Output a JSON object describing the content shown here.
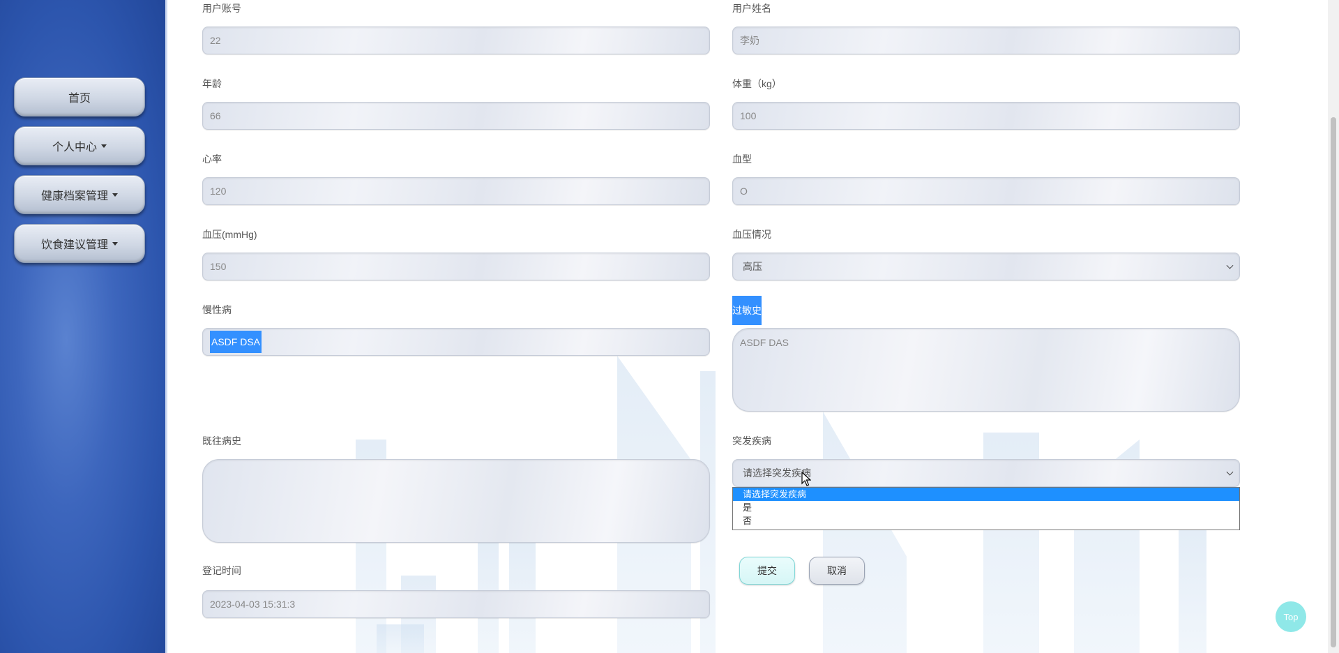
{
  "sidebar": {
    "items": [
      {
        "label": "首页",
        "has_caret": false
      },
      {
        "label": "个人中心",
        "has_caret": true
      },
      {
        "label": "健康档案管理",
        "has_caret": true
      },
      {
        "label": "饮食建议管理",
        "has_caret": true
      }
    ]
  },
  "form": {
    "account": {
      "label": "用户账号",
      "value": "22"
    },
    "name": {
      "label": "用户姓名",
      "value": "李奶"
    },
    "age": {
      "label": "年龄",
      "value": "66"
    },
    "weight": {
      "label": "体重（kg）",
      "value": "100"
    },
    "heart_rate": {
      "label": "心率",
      "value": "120"
    },
    "blood_type": {
      "label": "血型",
      "value": "O"
    },
    "blood_pressure": {
      "label": "血压(mmHg)",
      "value": "150"
    },
    "bp_status": {
      "label": "血压情况",
      "value": "高压"
    },
    "chronic": {
      "label": "慢性病",
      "value": "ASDF DSA"
    },
    "allergy": {
      "label": "过敏史",
      "value": "ASDF DAS"
    },
    "history": {
      "label": "既往病史",
      "value": ""
    },
    "sudden": {
      "label": "突发疾病",
      "placeholder": "请选择突发疾病",
      "options": [
        "请选择突发疾病",
        "是",
        "否"
      ]
    },
    "register_time": {
      "label": "登记时间",
      "value": "2023-04-03 15:31:3"
    },
    "submit_label": "提交",
    "cancel_label": "取消"
  },
  "top_button": "Top",
  "colors": {
    "sidebar": "#2c55ad",
    "selection": "#3390ff",
    "submit_border": "#7fd6d6",
    "top_button": "#8fe8e8"
  }
}
